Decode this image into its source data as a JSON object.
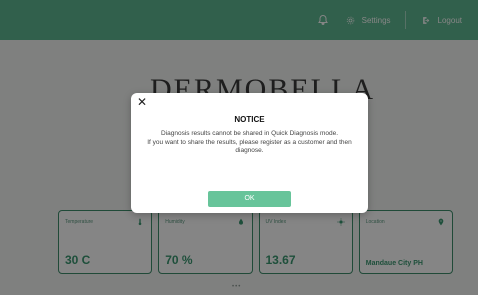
{
  "header": {
    "settings_label": "Settings",
    "logout_label": "Logout",
    "bell_icon": "bell-icon",
    "gear_icon": "gear-icon",
    "logout_icon": "logout-icon",
    "accent_color": "#5fb892"
  },
  "logo": {
    "text": "DERMOBELLA"
  },
  "cards": [
    {
      "label": "Temperature",
      "value": "30 C",
      "icon": "thermometer-icon"
    },
    {
      "label": "Humidity",
      "value": "70 %",
      "icon": "droplet-icon"
    },
    {
      "label": "UV Index",
      "value": "13.67",
      "icon": "sun-icon"
    },
    {
      "label": "Location",
      "value": "Mandaue City PH",
      "icon": "location-pin-icon"
    }
  ],
  "modal": {
    "title": "NOTICE",
    "line1": "Diagnosis results cannot be shared in Quick Diagnosis mode.",
    "line2": "If you want to share the results, please register as a customer and then diagnose.",
    "ok_label": "OK",
    "close_icon": "close-icon"
  }
}
